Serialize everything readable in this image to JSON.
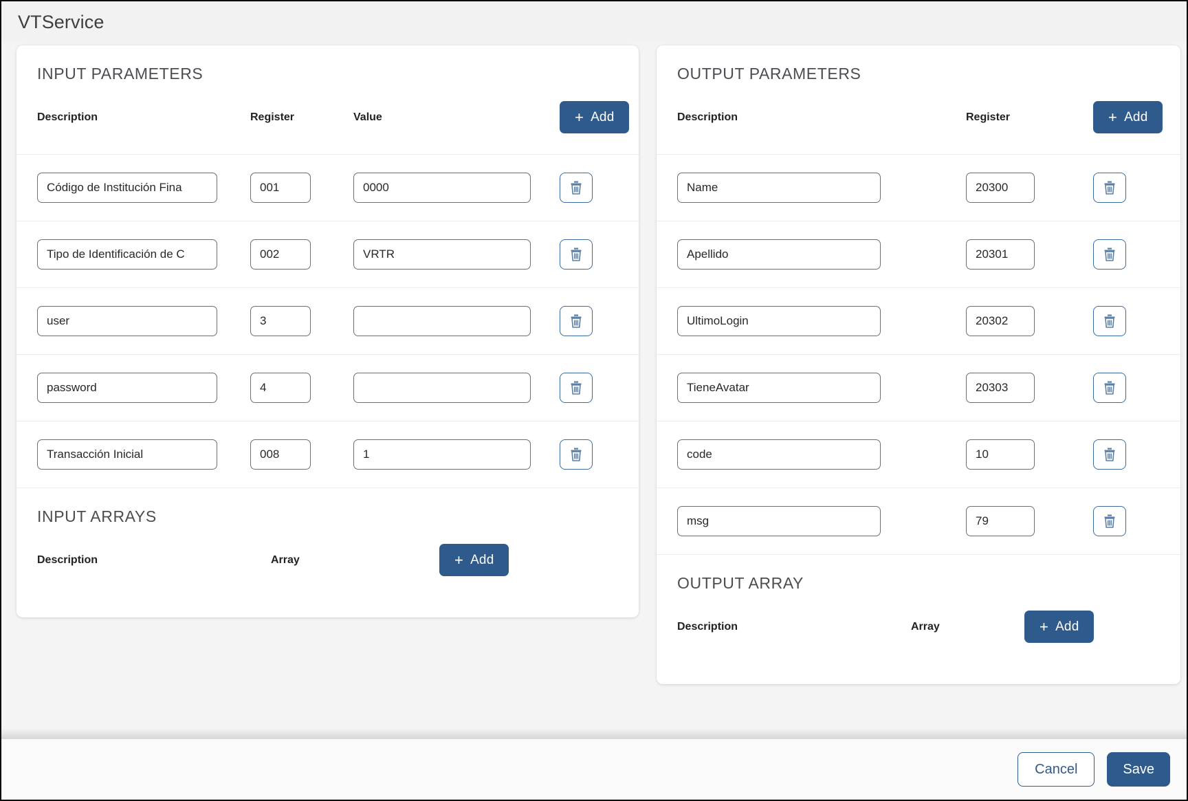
{
  "window": {
    "title": "VTService"
  },
  "input_parameters": {
    "section_title": "INPUT PARAMETERS",
    "columns": {
      "description": "Description",
      "register": "Register",
      "value": "Value"
    },
    "add_label": "Add",
    "add_icon": "plus-icon",
    "delete_icon": "trash-icon",
    "rows": [
      {
        "description": "Código de Institución Fina",
        "register": "001",
        "value": "0000"
      },
      {
        "description": "Tipo de Identificación de C",
        "register": "002",
        "value": "VRTR"
      },
      {
        "description": "user",
        "register": "3",
        "value": ""
      },
      {
        "description": "password",
        "register": "4",
        "value": ""
      },
      {
        "description": "Transacción Inicial",
        "register": "008",
        "value": "1"
      }
    ]
  },
  "input_arrays": {
    "section_title": "INPUT ARRAYS",
    "columns": {
      "description": "Description",
      "array": "Array"
    },
    "add_label": "Add",
    "add_icon": "plus-icon",
    "rows": []
  },
  "output_parameters": {
    "section_title": "OUTPUT PARAMETERS",
    "columns": {
      "description": "Description",
      "register": "Register"
    },
    "add_label": "Add",
    "add_icon": "plus-icon",
    "delete_icon": "trash-icon",
    "rows": [
      {
        "description": "Name",
        "register": "20300"
      },
      {
        "description": "Apellido",
        "register": "20301"
      },
      {
        "description": "UltimoLogin",
        "register": "20302"
      },
      {
        "description": "TieneAvatar",
        "register": "20303"
      },
      {
        "description": "code",
        "register": "10"
      },
      {
        "description": "msg",
        "register": "79"
      }
    ]
  },
  "output_array": {
    "section_title": "OUTPUT ARRAY",
    "columns": {
      "description": "Description",
      "array": "Array"
    },
    "add_label": "Add",
    "add_icon": "plus-icon",
    "rows": []
  },
  "footer": {
    "cancel_label": "Cancel",
    "save_label": "Save"
  },
  "colors": {
    "accent": "#2f5a8c",
    "page_background": "#f4f4f5",
    "card_background": "#ffffff",
    "input_border": "#6b6f74",
    "divider": "#ededef"
  }
}
